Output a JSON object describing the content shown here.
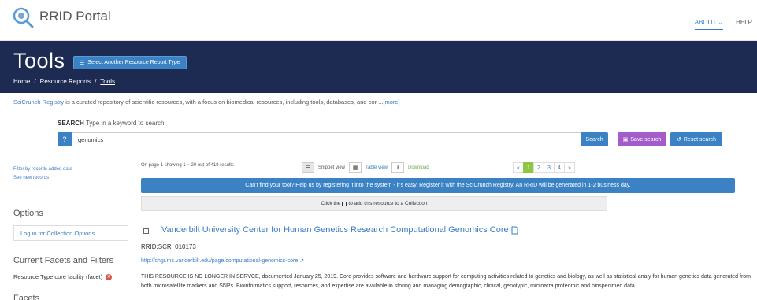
{
  "header": {
    "brand": "RRID Portal",
    "nav": [
      "ABOUT",
      "HELP"
    ]
  },
  "banner": {
    "title": "Tools",
    "select_button": "Select Another Resource Report Type",
    "breadcrumbs": [
      "Home",
      "Resource Reports",
      "Tools"
    ]
  },
  "description": {
    "link": "SciCrunch Registry",
    "text": " is a curated repository of scientific resources, with a focus on biomedical resources, including tools, databases, and cor ...",
    "more": "[more]"
  },
  "search": {
    "label_bold": "SEARCH",
    "label_rest": " Type in a keyword to search",
    "value": "genomics",
    "search_button": "Search",
    "save_button": "Save search",
    "reset_button": "Reset search"
  },
  "sidebar": {
    "filter_link": "Filter by records added date",
    "new_link": "See new records",
    "options_heading": "Options",
    "login_button": "Log in for Collection Options",
    "facets_heading": "Current Facets and Filters",
    "active_facet": "Resource Type:core facility (facet)",
    "facets_heading2": "Facets"
  },
  "results": {
    "page_info": "On page 1 showing 1 ~ 20 out of 419 results",
    "snippet_view": "Snippet view",
    "table_view": "Table view",
    "download": "Download",
    "pagination": [
      "«",
      "1",
      "2",
      "3",
      "4",
      "»"
    ],
    "info_bar": "Can't find your tool? Help us by registering it into the system - it's easy. Register it with the SciCrunch Registry. An RRID will be generated in 1-2 business day.",
    "collect_pre": "Click the",
    "collect_post": "to add this resource to a Collection",
    "item": {
      "title": "Vanderbilt University Center for Human Genetics Research Computational Genomics Core",
      "rrid": "RRID:SCR_010173",
      "url": "http://chgr.mc.vanderbilt.edu/page/computational-genomics-core",
      "description": "THIS RESOURCE IS NO LONGER IN SERVCE, documented January 25, 2019. Core provides software and hardware support for computing activities related to genetics and biology, as well as statistical analy for human genetics data generated from both microsatellite markers and SNPs. Bioinformatics support, resources, and expertise are available in storing and managing demographic, clinical, genotypic, microarra proteomic and biospecimen data."
    }
  },
  "colors": {
    "navy": "#1d2b53",
    "accent": "#3b82c4",
    "save": "#a35dcb",
    "page_active": "#8dc63f"
  }
}
